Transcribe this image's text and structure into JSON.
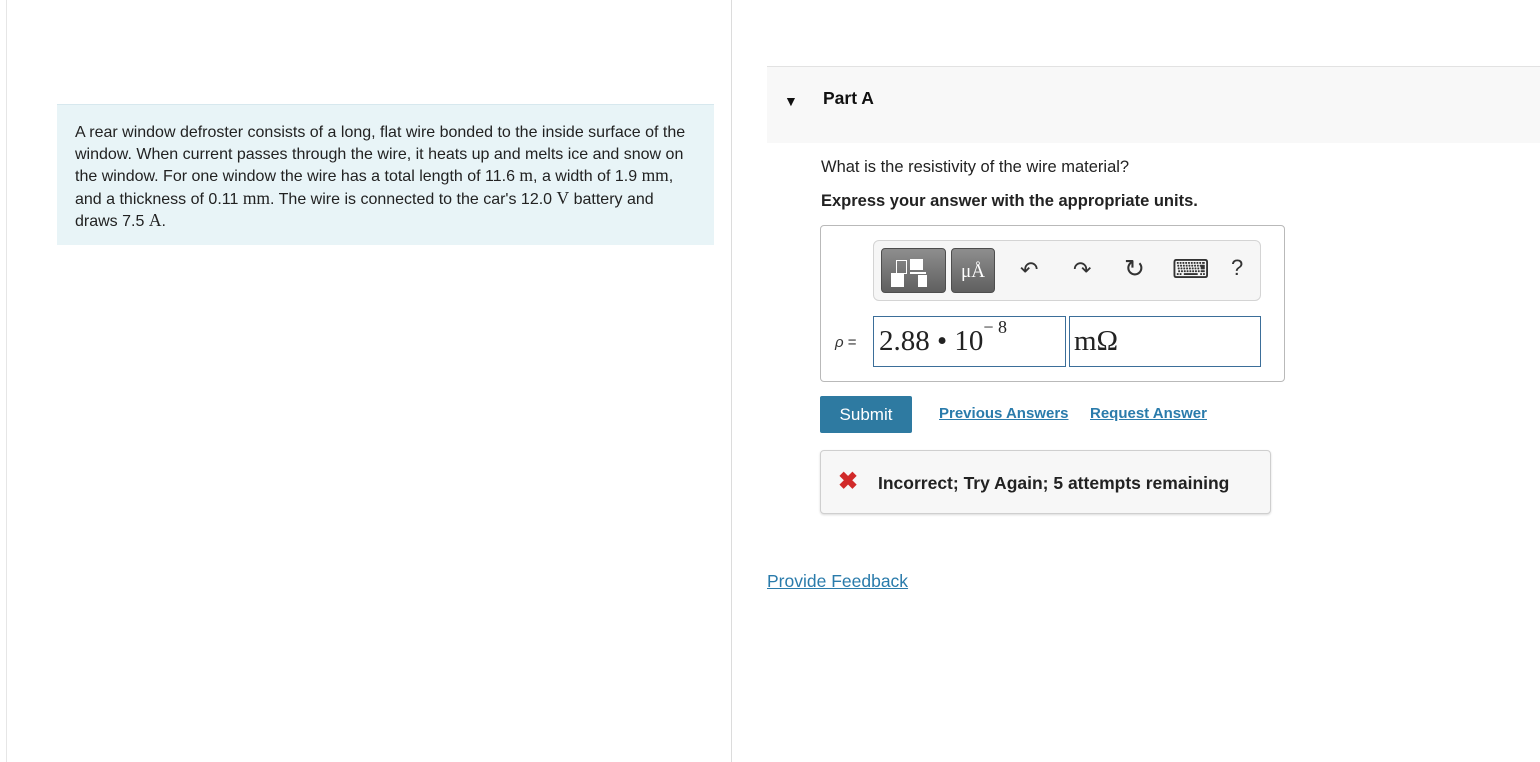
{
  "problem": {
    "text_1": "A rear window defroster consists of a long, flat wire bonded to the inside surface of the window. When current passes through the wire, it heats up and melts ice and snow on the window. For one window the wire has a total length of 11.6 ",
    "unit_m": "m",
    "text_2": ", a width of 1.9 ",
    "unit_mm_1": "mm",
    "text_3": ", and a thickness of 0.11 ",
    "unit_mm_2": "mm",
    "text_4": ". The wire is connected to the car's 12.0 ",
    "unit_v": "V",
    "text_5": " battery and draws 7.5 ",
    "unit_a": "A",
    "text_6": "."
  },
  "part": {
    "title": "Part A",
    "question": "What is the resistivity of the wire material?",
    "instruction": "Express your answer with the appropriate units."
  },
  "toolbar": {
    "units_glyph": "μÅ",
    "undo_glyph": "↶",
    "redo_glyph": "↷",
    "reset_glyph": "↻",
    "keyboard_glyph": "⌨",
    "help_glyph": "?"
  },
  "answer": {
    "variable_label": "ρ",
    "equals": " =",
    "value_mantissa": "2.88 • 10",
    "value_exponent": "− 8",
    "unit": "mΩ"
  },
  "actions": {
    "submit_label": "Submit",
    "previous_answers_label": "Previous Answers",
    "request_answer_label": "Request Answer"
  },
  "feedback": {
    "status_glyph": "✖",
    "message": "Incorrect; Try Again; 5 attempts remaining"
  },
  "footer": {
    "provide_feedback_label": "Provide Feedback"
  },
  "colors": {
    "problem_bg": "#e8f4f7",
    "submit_bg": "#2e7aa1",
    "link": "#2a7bab",
    "error": "#d12a2a"
  }
}
